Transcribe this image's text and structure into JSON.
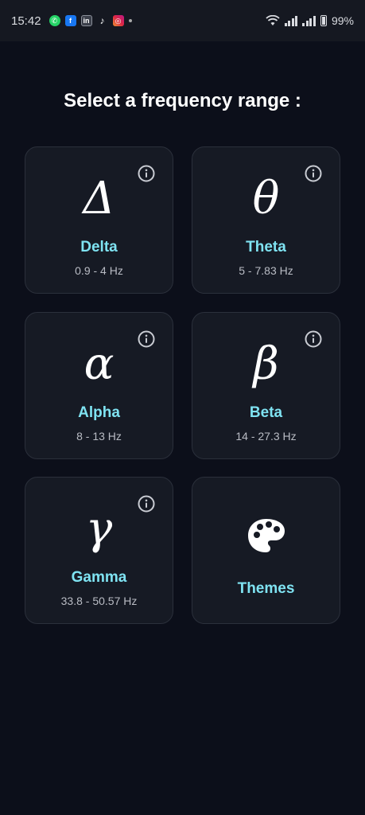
{
  "status_bar": {
    "time": "15:42",
    "battery": "99%",
    "notification_icons": [
      "whatsapp-icon",
      "facebook-icon",
      "linkedin-icon",
      "tiktok-icon",
      "instagram-icon"
    ]
  },
  "title": "Select a frequency range :",
  "cards": [
    {
      "symbol": "Δ",
      "name": "Delta",
      "range": "0.9 - 4 Hz"
    },
    {
      "symbol": "θ",
      "name": "Theta",
      "range": "5 - 7.83 Hz"
    },
    {
      "symbol": "α",
      "name": "Alpha",
      "range": "8 - 13 Hz"
    },
    {
      "symbol": "β",
      "name": "Beta",
      "range": "14 - 27.3 Hz"
    },
    {
      "symbol": "γ",
      "name": "Gamma",
      "range": "33.8 - 50.57 Hz"
    }
  ],
  "themes": {
    "name": "Themes",
    "icon": "palette-icon"
  },
  "colors": {
    "background": "#0c0f1a",
    "card": "#161a24",
    "card_border": "#2b303b",
    "accent": "#7fe3f2",
    "subtext": "#b9bcc4"
  }
}
